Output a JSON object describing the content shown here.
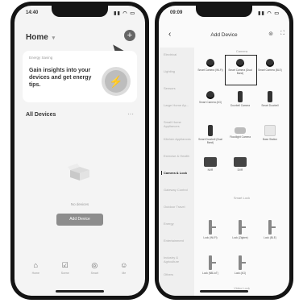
{
  "left_phone": {
    "status": {
      "time": "14:40",
      "icons": "▮▮ ◠ ▭"
    },
    "header": {
      "home_label": "Home",
      "chevron": "▾"
    },
    "plus_icon": "+",
    "energy_card": {
      "tag": "Energy Saving",
      "message": "Gain insights into your devices and get energy tips."
    },
    "section": {
      "title": "All Devices",
      "more": "···"
    },
    "empty": {
      "text": "No devices",
      "button": "Add Device"
    },
    "tabs": [
      {
        "icon": "⌂",
        "label": "Home"
      },
      {
        "icon": "☑",
        "label": "Scene"
      },
      {
        "icon": "◎",
        "label": "Smart"
      },
      {
        "icon": "☺",
        "label": "Me"
      }
    ]
  },
  "right_phone": {
    "status": {
      "time": "09:09",
      "icons": "▮▮ ◠ ▭"
    },
    "nav": {
      "back": "‹",
      "title": "Add Device",
      "gear_icon": "⊚",
      "scan_icon": "⛶"
    },
    "categories": [
      "Electrical",
      "Lighting",
      "Sensors",
      "Large Home Ap...",
      "Small Home Appliances",
      "Kitchen Appliances",
      "Exercise & Health",
      "Camera & Lock",
      "Gateway Control",
      "Outdoor Travel",
      "Energy",
      "Entertainment",
      "Industry & Agriculture",
      "Others"
    ],
    "active_category_index": 7,
    "groups": {
      "camera": "Camera",
      "smart_lock": "Smart Lock",
      "video_lock": "Video Lock"
    },
    "camera_items": [
      {
        "icon": "camera",
        "label": "Smart Camera (Wi-Fi)"
      },
      {
        "icon": "camera",
        "label": "Smart Camera (Dual Band)"
      },
      {
        "icon": "camera",
        "label": "Smart Camera (BLE)"
      },
      {
        "icon": "camera",
        "label": "Smart Camera (4G)"
      },
      {
        "icon": "doorbell",
        "label": "Doorbell Camera"
      },
      {
        "icon": "doorbell",
        "label": "Smart Doorbell"
      },
      {
        "icon": "doorbell",
        "label": "Smart Doorbell (Dual Band)"
      },
      {
        "icon": "floodlight",
        "label": "Floodlight Camera"
      },
      {
        "icon": "base-station",
        "label": "Base Station"
      },
      {
        "icon": "nvr",
        "label": "NVR"
      },
      {
        "icon": "nvr",
        "label": "DVR"
      }
    ],
    "lock_items": [
      {
        "icon": "lock",
        "label": "Lock (Wi-Fi)"
      },
      {
        "icon": "lock",
        "label": "Lock (Zigbee)"
      },
      {
        "icon": "lock",
        "label": "Lock (BLE)"
      },
      {
        "icon": "lock",
        "label": "Lock (NB-IoT)"
      },
      {
        "icon": "lock",
        "label": "Lock (4G)"
      }
    ]
  }
}
